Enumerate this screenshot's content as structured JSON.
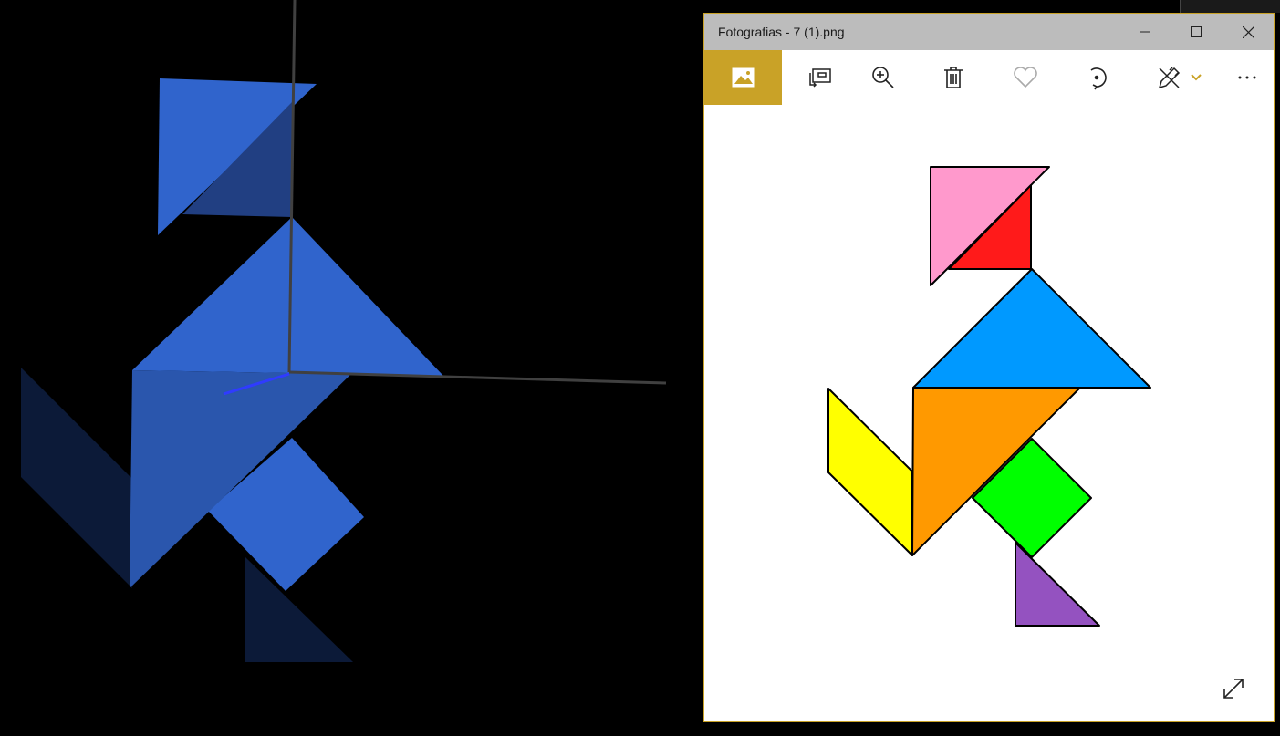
{
  "window": {
    "title": "Fotografias - 7 (1).png",
    "accent": "#c9a227",
    "caption_buttons": [
      "minimize-icon",
      "maximize-icon",
      "close-icon"
    ]
  },
  "toolbar": {
    "items": [
      "image-icon",
      "slideshow-icon",
      "zoom-in-icon",
      "delete-icon",
      "heart-icon",
      "rotate-icon",
      "edit-draw-icon",
      "chevron-down-icon",
      "more-icon"
    ]
  },
  "tangram_colors": {
    "pink": "#ff99cc",
    "red": "#ff1a1a",
    "blue": "#0099ff",
    "orange": "#ff9900",
    "yellow": "#ffff00",
    "green": "#00ff00",
    "purple": "#9452c0"
  },
  "scene3d_colors": {
    "face": "#3064cc",
    "shadow": "#16356e",
    "dark": "#0c1a38"
  }
}
